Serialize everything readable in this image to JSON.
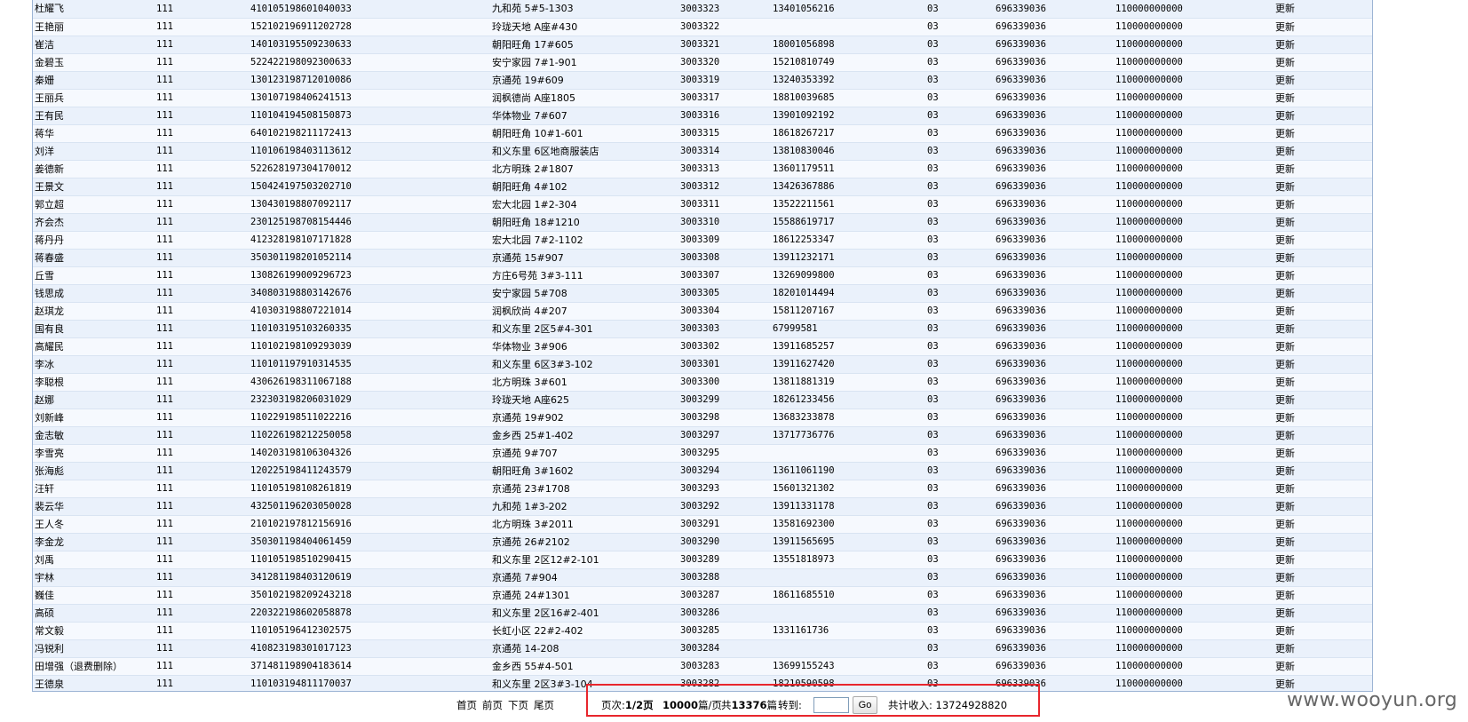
{
  "table": {
    "rows": [
      [
        "杜耀飞",
        "111",
        "410105198601040033",
        "九和苑 5#5-1303",
        "3003323",
        "13401056216",
        "03",
        "696339036",
        "110000000000",
        "更新"
      ],
      [
        "王艳丽",
        "111",
        "152102196911202728",
        "玲珑天地 A座#430",
        "3003322",
        "",
        "03",
        "696339036",
        "110000000000",
        "更新"
      ],
      [
        "崔洁",
        "111",
        "140103195509230633",
        "朝阳旺角 17#605",
        "3003321",
        "18001056898",
        "03",
        "696339036",
        "110000000000",
        "更新"
      ],
      [
        "金碧玉",
        "111",
        "522422198092300633",
        "安宁家园 7#1-901",
        "3003320",
        "15210810749",
        "03",
        "696339036",
        "110000000000",
        "更新"
      ],
      [
        "秦姗",
        "111",
        "130123198712010086",
        "京通苑 19#609",
        "3003319",
        "13240353392",
        "03",
        "696339036",
        "110000000000",
        "更新"
      ],
      [
        "王丽兵",
        "111",
        "130107198406241513",
        "润枫德尚 A座1805",
        "3003317",
        "18810039685",
        "03",
        "696339036",
        "110000000000",
        "更新"
      ],
      [
        "王有民",
        "111",
        "110104194508150873",
        "华体物业 7#607",
        "3003316",
        "13901092192",
        "03",
        "696339036",
        "110000000000",
        "更新"
      ],
      [
        "蒋华",
        "111",
        "640102198211172413",
        "朝阳旺角 10#1-601",
        "3003315",
        "18618267217",
        "03",
        "696339036",
        "110000000000",
        "更新"
      ],
      [
        "刘洋",
        "111",
        "110106198403113612",
        "和义东里 6区地商服装店",
        "3003314",
        "13810830046",
        "03",
        "696339036",
        "110000000000",
        "更新"
      ],
      [
        "姜德新",
        "111",
        "522628197304170012",
        "北方明珠 2#1807",
        "3003313",
        "13601179511",
        "03",
        "696339036",
        "110000000000",
        "更新"
      ],
      [
        "王景文",
        "111",
        "150424197503202710",
        "朝阳旺角 4#102",
        "3003312",
        "13426367886",
        "03",
        "696339036",
        "110000000000",
        "更新"
      ],
      [
        "郭立超",
        "111",
        "130430198807092117",
        "宏大北园 1#2-304",
        "3003311",
        "13522211561",
        "03",
        "696339036",
        "110000000000",
        "更新"
      ],
      [
        "齐会杰",
        "111",
        "230125198708154446",
        "朝阳旺角 18#1210",
        "3003310",
        "15588619717",
        "03",
        "696339036",
        "110000000000",
        "更新"
      ],
      [
        "蒋丹丹",
        "111",
        "412328198107171828",
        "宏大北园 7#2-1102",
        "3003309",
        "18612253347",
        "03",
        "696339036",
        "110000000000",
        "更新"
      ],
      [
        "蒋春盛",
        "111",
        "350301198201052114",
        "京通苑 15#907",
        "3003308",
        "13911232171",
        "03",
        "696339036",
        "110000000000",
        "更新"
      ],
      [
        "丘雪",
        "111",
        "130826199009296723",
        "方庄6号苑 3#3-111",
        "3003307",
        "13269099800",
        "03",
        "696339036",
        "110000000000",
        "更新"
      ],
      [
        "钱思成",
        "111",
        "340803198803142676",
        "安宁家园 5#708",
        "3003305",
        "18201014494",
        "03",
        "696339036",
        "110000000000",
        "更新"
      ],
      [
        "赵琪龙",
        "111",
        "410303198807221014",
        "润枫欣尚 4#207",
        "3003304",
        "15811207167",
        "03",
        "696339036",
        "110000000000",
        "更新"
      ],
      [
        "国有良",
        "111",
        "110103195103260335",
        "和义东里 2区5#4-301",
        "3003303",
        "67999581",
        "03",
        "696339036",
        "110000000000",
        "更新"
      ],
      [
        "高耀民",
        "111",
        "110102198109293039",
        "华体物业 3#906",
        "3003302",
        "13911685257",
        "03",
        "696339036",
        "110000000000",
        "更新"
      ],
      [
        "李冰",
        "111",
        "110101197910314535",
        "和义东里 6区3#3-102",
        "3003301",
        "13911627420",
        "03",
        "696339036",
        "110000000000",
        "更新"
      ],
      [
        "李聪根",
        "111",
        "430626198311067188",
        "北方明珠 3#601",
        "3003300",
        "13811881319",
        "03",
        "696339036",
        "110000000000",
        "更新"
      ],
      [
        "赵娜",
        "111",
        "232303198206031029",
        "玲珑天地 A座625",
        "3003299",
        "18261233456",
        "03",
        "696339036",
        "110000000000",
        "更新"
      ],
      [
        "刘新峰",
        "111",
        "110229198511022216",
        "京通苑 19#902",
        "3003298",
        "13683233878",
        "03",
        "696339036",
        "110000000000",
        "更新"
      ],
      [
        "金志敏",
        "111",
        "110226198212250058",
        "金乡西 25#1-402",
        "3003297",
        "13717736776",
        "03",
        "696339036",
        "110000000000",
        "更新"
      ],
      [
        "李雪亮",
        "111",
        "140203198106304326",
        "京通苑 9#707",
        "3003295",
        "",
        "03",
        "696339036",
        "110000000000",
        "更新"
      ],
      [
        "张海彪",
        "111",
        "120225198411243579",
        "朝阳旺角 3#1602",
        "3003294",
        "13611061190",
        "03",
        "696339036",
        "110000000000",
        "更新"
      ],
      [
        "汪轩",
        "111",
        "110105198108261819",
        "京通苑 23#1708",
        "3003293",
        "15601321302",
        "03",
        "696339036",
        "110000000000",
        "更新"
      ],
      [
        "裴云华",
        "111",
        "432501196203050028",
        "九和苑 1#3-202",
        "3003292",
        "13911331178",
        "03",
        "696339036",
        "110000000000",
        "更新"
      ],
      [
        "王人冬",
        "111",
        "210102197812156916",
        "北方明珠 3#2011",
        "3003291",
        "13581692300",
        "03",
        "696339036",
        "110000000000",
        "更新"
      ],
      [
        "李金龙",
        "111",
        "350301198404061459",
        "京通苑 26#2102",
        "3003290",
        "13911565695",
        "03",
        "696339036",
        "110000000000",
        "更新"
      ],
      [
        "刘禹",
        "111",
        "110105198510290415",
        "和义东里 2区12#2-101",
        "3003289",
        "13551818973",
        "03",
        "696339036",
        "110000000000",
        "更新"
      ],
      [
        "宇林",
        "111",
        "341281198403120619",
        "京通苑 7#904",
        "3003288",
        "",
        "03",
        "696339036",
        "110000000000",
        "更新"
      ],
      [
        "巍佳",
        "111",
        "350102198209243218",
        "京通苑 24#1301",
        "3003287",
        "18611685510",
        "03",
        "696339036",
        "110000000000",
        "更新"
      ],
      [
        "高硕",
        "111",
        "220322198602058878",
        "和义东里 2区16#2-401",
        "3003286",
        "",
        "03",
        "696339036",
        "110000000000",
        "更新"
      ],
      [
        "常文毅",
        "111",
        "110105196412302575",
        "长虹小区 22#2-402",
        "3003285",
        "1331161736",
        "03",
        "696339036",
        "110000000000",
        "更新"
      ],
      [
        "冯锐利",
        "111",
        "410823198301017123",
        "京通苑 14-208",
        "3003284",
        "",
        "03",
        "696339036",
        "110000000000",
        "更新"
      ],
      [
        "田增强（退费删除）",
        "111",
        "371481198904183614",
        "金乡西 55#4-501",
        "3003283",
        "13699155243",
        "03",
        "696339036",
        "110000000000",
        "更新"
      ],
      [
        "王德泉",
        "111",
        "110103194811170037",
        "和义东里 2区3#3-104",
        "3003282",
        "18210590598",
        "03",
        "696339036",
        "110000000000",
        "更新"
      ]
    ]
  },
  "pager": {
    "first": "首页",
    "prev": "前页",
    "next": "下页",
    "last": "尾页",
    "page_label": "页次:",
    "page_value": "1/2页",
    "per_page_value": "10000",
    "per_page_unit": "篇/页",
    "total_label": "共",
    "total_value": "13376",
    "total_unit": "篇",
    "goto_label": "转到:",
    "goto_value": "",
    "go_label": "Go",
    "income_label": "共计收入:",
    "income_value": "13724928820"
  },
  "watermark": "www.wooyun.org",
  "colors": {
    "highlight": "#e8262d",
    "row_bg_a": "#eaf1fb",
    "row_bg_b": "#f6f9fe",
    "border": "#9cb4d4"
  }
}
